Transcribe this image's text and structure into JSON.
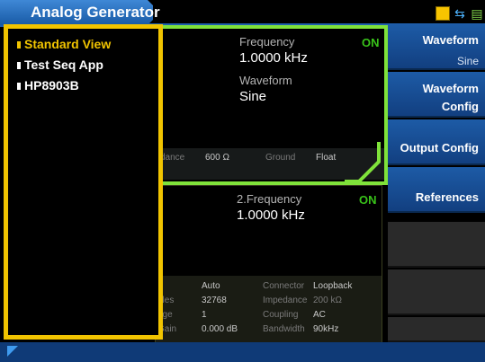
{
  "title": "Analog Generator",
  "icons": {
    "home": "home-icon",
    "usb": "usb-icon",
    "network": "network-icon"
  },
  "colors": {
    "accent": "#1d5ba6",
    "menu_border": "#f1c400",
    "active_channel": "#7fe23a",
    "on": "#39c21a"
  },
  "menu": {
    "items": [
      {
        "label": "Standard View",
        "selected": true
      },
      {
        "label": "Test Seq App",
        "selected": false
      },
      {
        "label": "HP8903B",
        "selected": false
      }
    ]
  },
  "channel1": {
    "frequency_label": "Frequency",
    "frequency_value": "1.0000 kHz",
    "status": "ON",
    "waveform_label": "Waveform",
    "waveform_value": "Sine",
    "impedance_label_partial": "dance",
    "impedance_value": "600 Ω",
    "ground_label": "Ground",
    "ground_value": "Float"
  },
  "channel2": {
    "frequency_label": "2.Frequency",
    "frequency_value": "1.0000 kHz",
    "status": "ON",
    "left_rows": [
      {
        "label": "e",
        "value": "Auto"
      },
      {
        "label": "ples",
        "value": "32768"
      },
      {
        "label": "age",
        "value": "1"
      },
      {
        "label": "Gain",
        "value": "0.000 dB"
      }
    ],
    "right_rows": [
      {
        "label": "Connector",
        "value": "Loopback"
      },
      {
        "label": "Impedance",
        "value": "200 kΩ"
      },
      {
        "label": "Coupling",
        "value": "AC"
      },
      {
        "label": "Bandwidth",
        "value": "90kHz"
      }
    ]
  },
  "softkeys": [
    {
      "line1": "Waveform",
      "line2": "Sine"
    },
    {
      "line1": "Waveform",
      "line2": "Config"
    },
    {
      "line1": "Output Config",
      "line2": ""
    },
    {
      "line1": "References",
      "line2": ""
    },
    {
      "line1": "",
      "line2": ""
    },
    {
      "line1": "",
      "line2": ""
    },
    {
      "line1": "",
      "line2": ""
    }
  ]
}
